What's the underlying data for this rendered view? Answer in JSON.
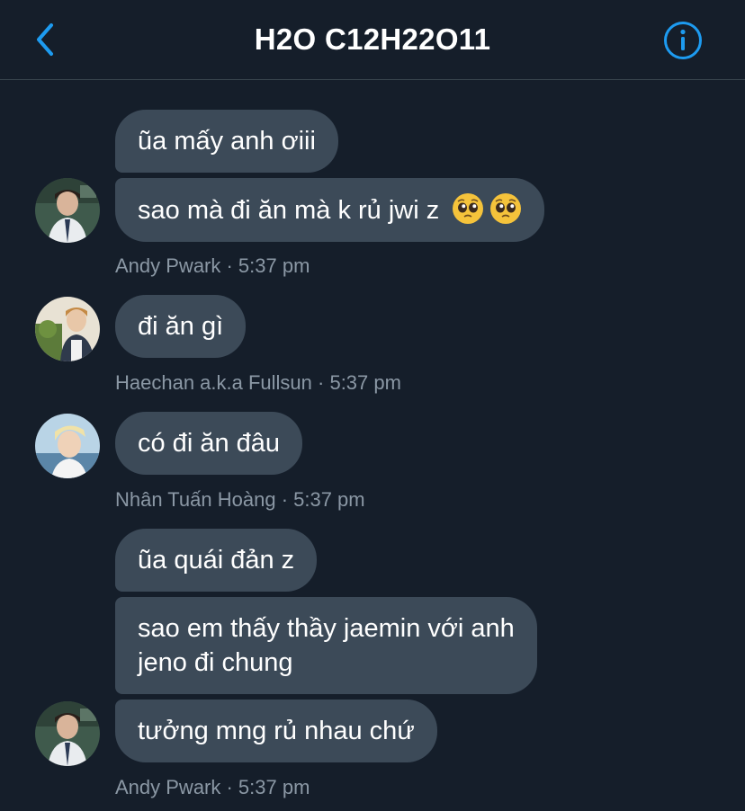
{
  "header": {
    "title": "H2O C12H22O11",
    "back_icon": "chevron-left-icon",
    "info_icon": "info-icon",
    "accent_color": "#1d9bf0"
  },
  "messages": [
    {
      "sender": "Andy Pwark",
      "time": "5:37 pm",
      "meta": "Andy Pwark · 5:37 pm",
      "bubbles": [
        "ũa mấy anh ơiii",
        "sao mà đi ăn mà k rủ jwi z"
      ],
      "emojis": [
        "pleading-face-emoji",
        "pleading-face-emoji"
      ]
    },
    {
      "sender": "Haechan a.k.a Fullsun",
      "time": "5:37 pm",
      "meta": "Haechan a.k.a Fullsun · 5:37 pm",
      "bubbles": [
        "đi ăn gì"
      ]
    },
    {
      "sender": "Nhân Tuấn Hoàng",
      "time": "5:37 pm",
      "meta": "Nhân Tuấn Hoàng · 5:37 pm",
      "bubbles": [
        "có đi ăn đâu"
      ]
    },
    {
      "sender": "Andy Pwark",
      "time": "5:37 pm",
      "meta": "Andy Pwark · 5:37 pm",
      "bubbles": [
        "ũa quái đản z",
        "sao em thấy thầy jaemin với anh",
        "jeno đi chung",
        "tưởng mng rủ nhau chứ"
      ]
    }
  ],
  "colors": {
    "background": "#151e2a",
    "bubble": "#3c4a58",
    "meta_text": "#8b98a5"
  }
}
